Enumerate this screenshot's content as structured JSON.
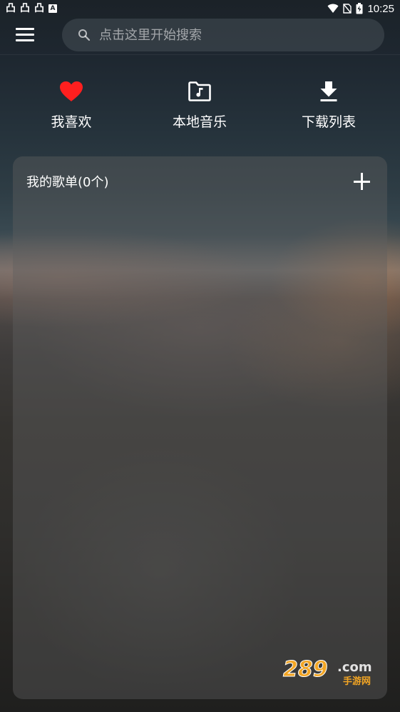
{
  "status_bar": {
    "time": "10:25",
    "notification_glyphs": [
      "凸",
      "凸",
      "凸"
    ],
    "a_label": "A"
  },
  "search": {
    "placeholder": "点击这里开始搜索"
  },
  "quick_actions": [
    {
      "label": "我喜欢",
      "icon": "heart-icon",
      "color": "#ff1f1f"
    },
    {
      "label": "本地音乐",
      "icon": "music-folder-icon",
      "color": "#ffffff"
    },
    {
      "label": "下载列表",
      "icon": "download-icon",
      "color": "#ffffff"
    }
  ],
  "playlist": {
    "title": "我的歌单(0个)"
  },
  "watermark": {
    "brand_number": "289",
    "brand_suffix": ".com",
    "brand_sub": "手游网"
  }
}
